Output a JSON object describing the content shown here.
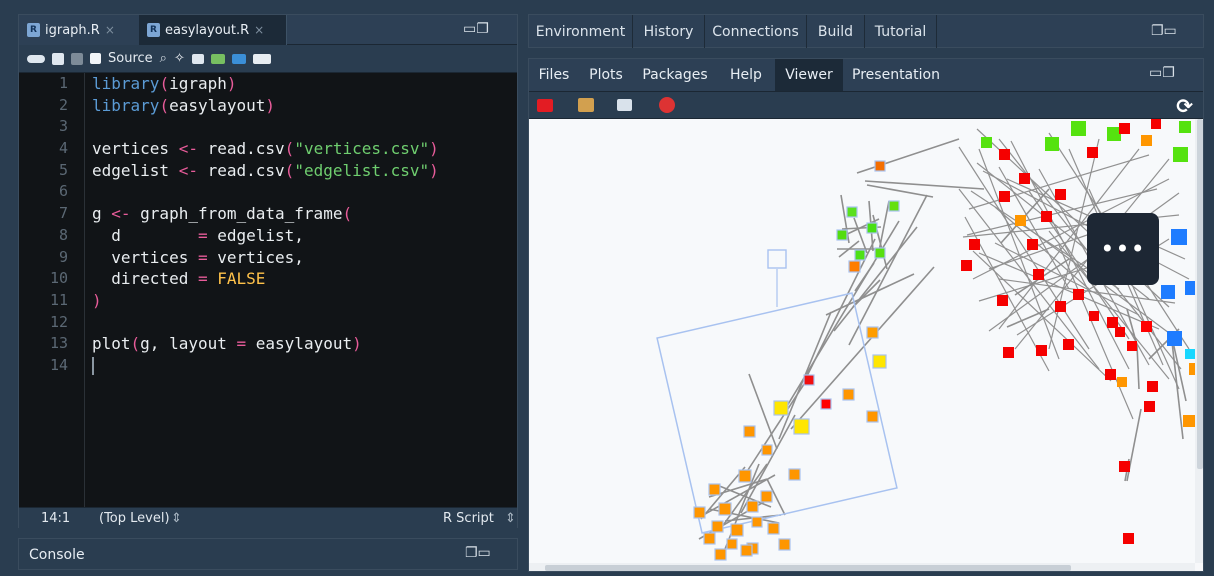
{
  "editor": {
    "tabs": [
      {
        "label": "igraph.R"
      },
      {
        "label": "easylayout.R"
      }
    ],
    "source_label": "Source",
    "lines": [
      "1",
      "2",
      "3",
      "4",
      "5",
      "6",
      "7",
      "8",
      "9",
      "10",
      "11",
      "12",
      "13",
      "14"
    ],
    "status": {
      "position": "14:1",
      "scope": "(Top Level)",
      "language": "R Script"
    }
  },
  "console": {
    "label": "Console"
  },
  "env_tabs": [
    {
      "label": "Environment"
    },
    {
      "label": "History"
    },
    {
      "label": "Connections"
    },
    {
      "label": "Build"
    },
    {
      "label": "Tutorial"
    }
  ],
  "viewer_tabs": [
    {
      "label": "Files"
    },
    {
      "label": "Plots"
    },
    {
      "label": "Packages"
    },
    {
      "label": "Help"
    },
    {
      "label": "Viewer"
    },
    {
      "label": "Presentation"
    }
  ],
  "overlay_button": "•••",
  "colors": {
    "orange": "#ff9900",
    "yellow": "#ffe500",
    "red": "#f50000",
    "green": "#55e20f",
    "blue": "#1e7cff",
    "cyan": "#17d7ff",
    "edge": "#8c8c8c"
  }
}
